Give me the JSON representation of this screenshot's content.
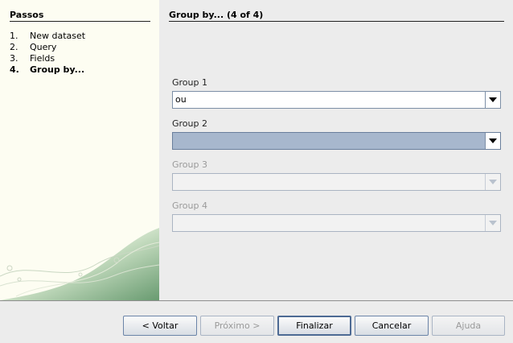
{
  "steps": {
    "title": "Passos",
    "items": [
      {
        "num": "1.",
        "label": "New dataset"
      },
      {
        "num": "2.",
        "label": "Query"
      },
      {
        "num": "3.",
        "label": "Fields"
      },
      {
        "num": "4.",
        "label": "Group by..."
      }
    ],
    "current_index": 3
  },
  "page": {
    "heading": "Group by... (4 of 4)"
  },
  "groups": [
    {
      "label": "Group 1",
      "value": "ou",
      "state": "normal"
    },
    {
      "label": "Group 2",
      "value": "",
      "state": "selected"
    },
    {
      "label": "Group 3",
      "value": "",
      "state": "disabled"
    },
    {
      "label": "Group 4",
      "value": "",
      "state": "disabled"
    }
  ],
  "buttons": {
    "back": "< Voltar",
    "next": "Próximo >",
    "finish": "Finalizar",
    "cancel": "Cancelar",
    "help": "Ajuda"
  },
  "colors": {
    "left_panel_bg": "#fdfdf2",
    "selection": "#a7b7cd",
    "decor_green": "#5d9a6a"
  }
}
